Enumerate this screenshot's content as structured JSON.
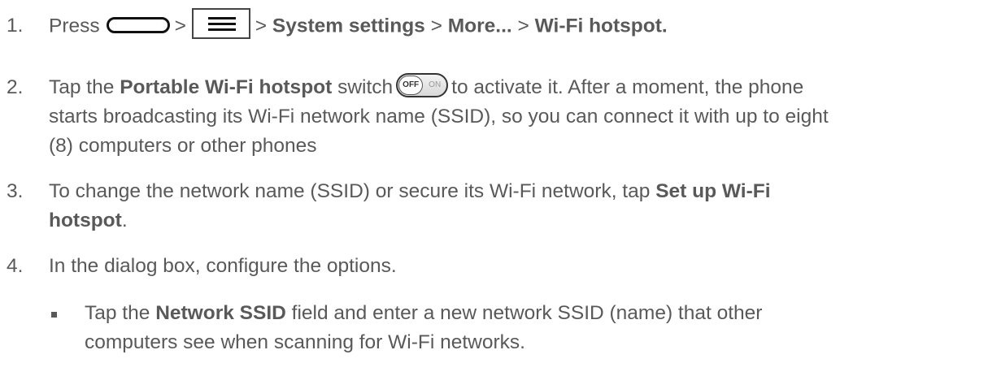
{
  "steps": [
    {
      "num": "1.",
      "press": "Press",
      "sep1": ">",
      "sep2": ">",
      "system_settings": "System settings",
      "sep3": ">",
      "more": "More...",
      "sep4": ">",
      "wifi_hotspot": "Wi-Fi hotspot."
    },
    {
      "num": "2.",
      "tap_the": "Tap the",
      "portable": "Portable Wi-Fi hotspot",
      "switch": "switch",
      "rest_line1": "to activate it. After a moment, the phone",
      "line2": "starts broadcasting its Wi-Fi network name (SSID), so you can connect it with up to eight",
      "line3": "(8) computers or other phones"
    },
    {
      "num": "3.",
      "text1": "To change the network name (SSID) or secure its Wi-Fi network, tap",
      "bold1": "Set up Wi-Fi",
      "bold2": "hotspot",
      "period": "."
    },
    {
      "num": "4.",
      "text": "In the dialog box, configure the options."
    }
  ],
  "sub": {
    "tap_the": "Tap the",
    "bold": "Network SSID",
    "rest_line1": "field and enter a new network SSID (name) that other",
    "line2": "computers see when scanning for Wi-Fi networks."
  },
  "icons": {
    "home": "home-button-icon",
    "menu": "menu-button-icon",
    "toggle": "off-on-switch-icon"
  },
  "toggle": {
    "off": "OFF",
    "on": "ON"
  }
}
